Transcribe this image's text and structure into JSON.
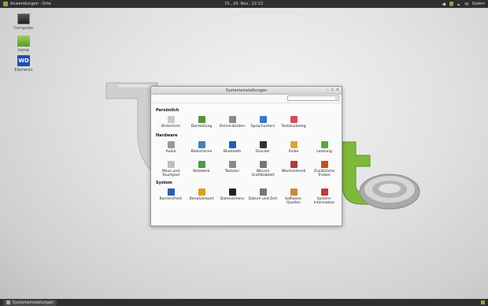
{
  "top_panel": {
    "menu_label": "Anwendungen · Orte",
    "clock": "Di., 24. Nov., 22:13",
    "user": "Golem"
  },
  "desktop": {
    "icons": [
      {
        "label": "Computer",
        "icon": "computer-icon"
      },
      {
        "label": "home",
        "icon": "home-folder-icon"
      },
      {
        "label": "Elements",
        "icon": "wd-drive-icon"
      }
    ]
  },
  "window": {
    "title": "Systemeinstellungen",
    "search": {
      "value": "",
      "placeholder": ""
    },
    "sections": [
      {
        "title": "Persönlich",
        "items": [
          {
            "label": "Bildschirm",
            "icon": "lock-screen-icon",
            "color": "#c9c9c9"
          },
          {
            "label": "Darstellung",
            "icon": "appearance-icon",
            "color": "#5f8f3e"
          },
          {
            "label": "Online-Konten",
            "icon": "online-accounts-icon",
            "color": "#8c8c8c"
          },
          {
            "label": "Sprachunters",
            "icon": "language-icon",
            "color": "#3a78c8"
          },
          {
            "label": "Tastaturbeleg",
            "icon": "keyboard-layout-icon",
            "color": "#d0505a"
          }
        ]
      },
      {
        "title": "Hardware",
        "items": [
          {
            "label": "Audio",
            "icon": "audio-icon",
            "color": "#9a9a9a"
          },
          {
            "label": "Bildschirme",
            "icon": "displays-icon",
            "color": "#4d7fb3"
          },
          {
            "label": "Bluetooth",
            "icon": "bluetooth-icon",
            "color": "#1f5fb4"
          },
          {
            "label": "Drucker",
            "icon": "printer-icon",
            "color": "#333333"
          },
          {
            "label": "Farbe",
            "icon": "color-icon",
            "color": "#e6a23c"
          },
          {
            "label": "Leistung",
            "icon": "power-icon",
            "color": "#5aa83a"
          },
          {
            "label": "Maus und Touchpad",
            "icon": "mouse-icon",
            "color": "#bfbfbf"
          },
          {
            "label": "Netzwerk",
            "icon": "network-icon",
            "color": "#4a9a4a"
          },
          {
            "label": "Tastatur",
            "icon": "keyboard-icon",
            "color": "#8a8a8a"
          },
          {
            "label": "Wacom Grafiktablett",
            "icon": "wacom-icon",
            "color": "#777777"
          },
          {
            "label": "Wechselmedi",
            "icon": "removable-media-icon",
            "color": "#b33a3a"
          },
          {
            "label": "Zusätzliche Treiber",
            "icon": "drivers-icon",
            "color": "#c05020"
          }
        ]
      },
      {
        "title": "System",
        "items": [
          {
            "label": "Barrierefreih",
            "icon": "accessibility-icon",
            "color": "#2a5fb0"
          },
          {
            "label": "Benutzerkont",
            "icon": "user-accounts-icon",
            "color": "#d6a320"
          },
          {
            "label": "Datensicheru",
            "icon": "backup-icon",
            "color": "#222222"
          },
          {
            "label": "Datum und Zeit",
            "icon": "clock-icon",
            "color": "#777777"
          },
          {
            "label": "Software-Quellen",
            "icon": "software-sources-icon",
            "color": "#c88a3a"
          },
          {
            "label": "System-Information",
            "icon": "system-info-icon",
            "color": "#c23a3a"
          }
        ]
      }
    ]
  },
  "bottom_panel": {
    "task_label": "Systemeinstellungen"
  }
}
